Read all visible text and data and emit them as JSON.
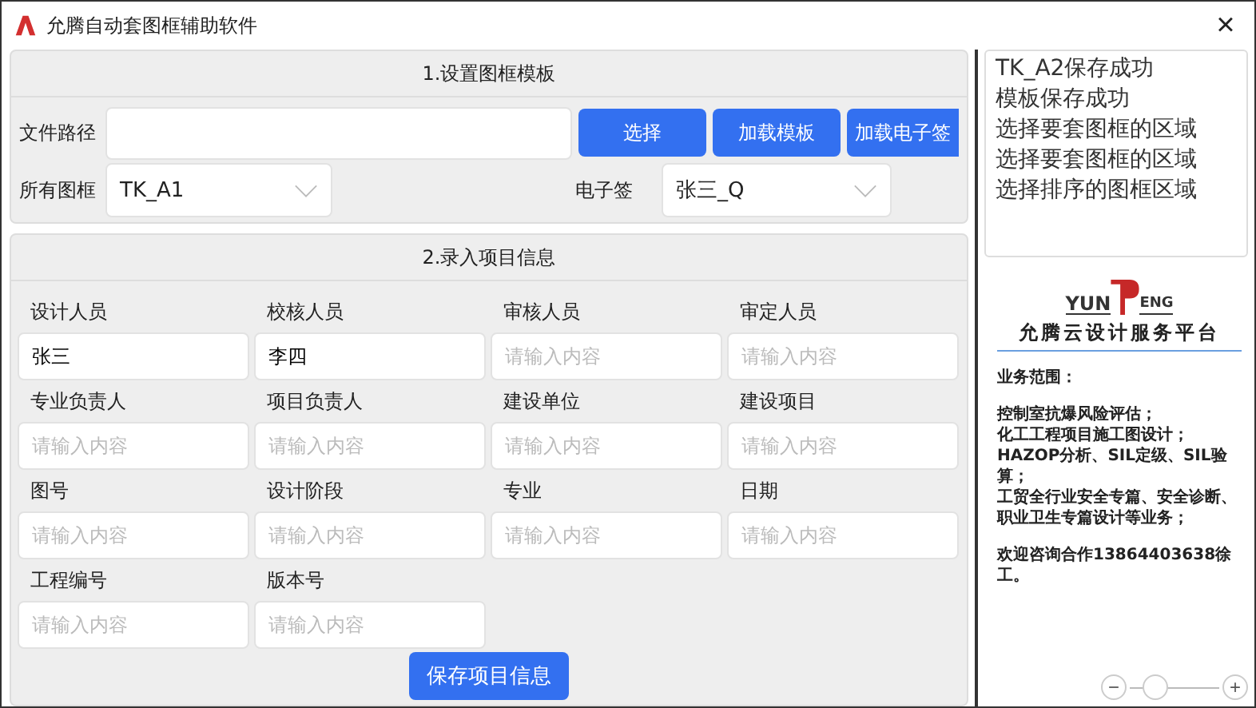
{
  "window": {
    "title": "允腾自动套图框辅助软件",
    "close": "×"
  },
  "template_section": {
    "title": "1.设置图框模板",
    "path_label": "文件路径",
    "buttons": [
      "选择",
      "加载模板",
      "加载电子签"
    ],
    "frame_label": "所有图框",
    "frame_value": "TK_A1",
    "sign_label": "电子签",
    "sign_value": "张三_Q"
  },
  "project_section": {
    "title": "2.录入项目信息",
    "fields": [
      {
        "label": "设计人员",
        "value": "张三"
      },
      {
        "label": "校核人员",
        "value": "李四"
      },
      {
        "label": "审核人员",
        "placeholder": "请输入内容"
      },
      {
        "label": "审定人员",
        "placeholder": "请输入内容"
      },
      {
        "label": "专业负责人",
        "placeholder": "请输入内容"
      },
      {
        "label": "项目负责人",
        "placeholder": "请输入内容"
      },
      {
        "label": "建设单位",
        "placeholder": "请输入内容"
      },
      {
        "label": "建设项目",
        "placeholder": "请输入内容"
      },
      {
        "label": "图号",
        "placeholder": "请输入内容"
      },
      {
        "label": "设计阶段",
        "placeholder": "请输入内容"
      },
      {
        "label": "专业",
        "placeholder": "请输入内容"
      },
      {
        "label": "日期",
        "placeholder": "请输入内容"
      },
      {
        "label": "工程编号",
        "placeholder": "请输入内容"
      },
      {
        "label": "版本号",
        "placeholder": "请输入内容"
      }
    ],
    "save_button": "保存项目信息"
  },
  "log": [
    "TK_A2保存成功",
    "模板保存成功",
    "选择要套图框的区域",
    "选择要套图框的区域",
    "选择排序的图框区域"
  ],
  "promo": {
    "logo_left": "YUN",
    "logo_right": "ENG",
    "title": "允腾云设计服务平台",
    "paragraphs": [
      [
        "业务范围："
      ],
      [
        "控制室抗爆风险评估；",
        "化工工程项目施工图设计；",
        "HAZOP分析、SIL定级、SIL验算；",
        "工贸全行业安全专篇、安全诊断、职业卫生专篇设计等业务；"
      ],
      [
        "欢迎咨询合作13864403638徐工。"
      ]
    ]
  },
  "zoom": {
    "minus": "−",
    "plus": "+",
    "level": 0.2
  }
}
